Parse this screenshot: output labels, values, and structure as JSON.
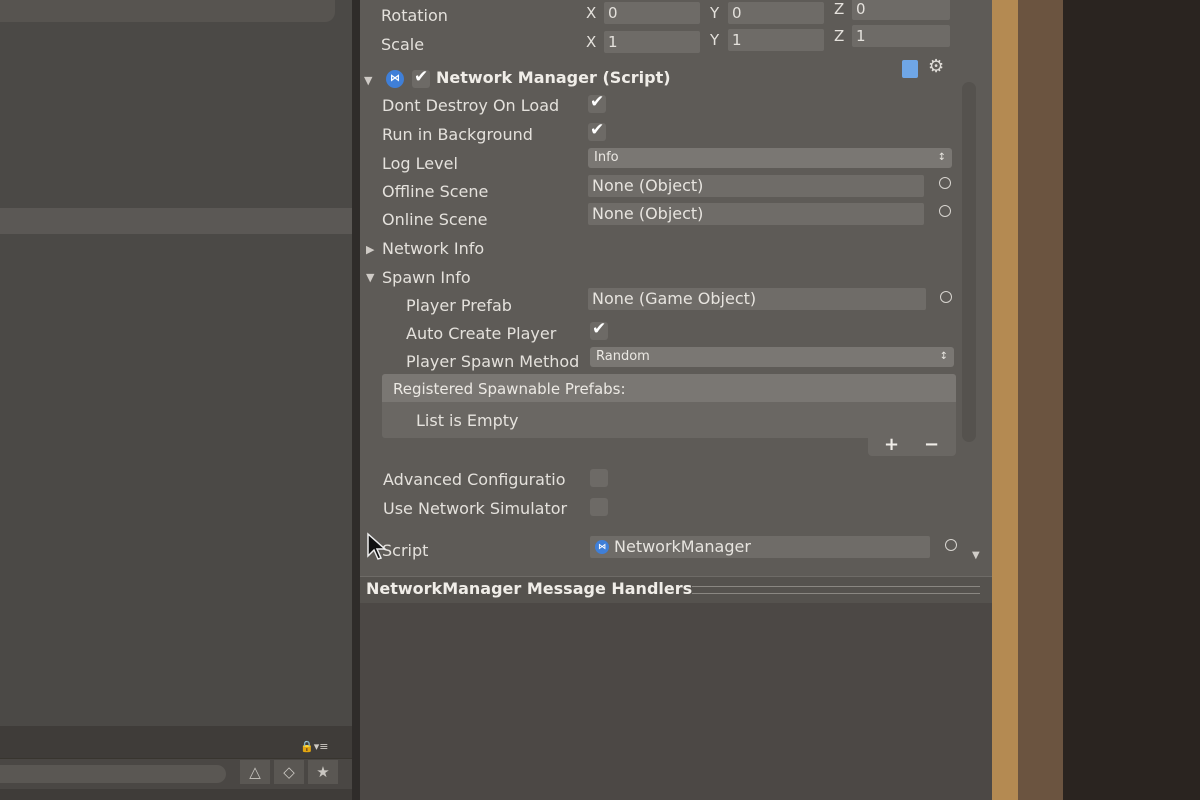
{
  "transform": {
    "rotation_label": "Rotation",
    "scale_label": "Scale",
    "rotation": {
      "x_axis": "X",
      "x": "0",
      "y_axis": "Y",
      "y": "0",
      "z_axis": "Z",
      "z": "0"
    },
    "scale": {
      "x_axis": "X",
      "x": "1",
      "y_axis": "Y",
      "y": "1",
      "z_axis": "Z",
      "z": "1"
    }
  },
  "component": {
    "title": "Network Manager (Script)",
    "icon_glyph": "⋈",
    "enabled": true
  },
  "fields": {
    "dont_destroy_label": "Dont Destroy On Load",
    "dont_destroy": true,
    "run_background_label": "Run in Background",
    "run_background": true,
    "log_level_label": "Log Level",
    "log_level": "Info",
    "offline_scene_label": "Offline Scene",
    "offline_scene": "None (Object)",
    "online_scene_label": "Online Scene",
    "online_scene": "None (Object)",
    "network_info_label": "Network Info",
    "spawn_info_label": "Spawn Info",
    "player_prefab_label": "Player Prefab",
    "player_prefab": "None (Game Object)",
    "auto_create_label": "Auto Create Player",
    "auto_create": true,
    "spawn_method_label": "Player Spawn Method",
    "spawn_method": "Random",
    "advanced_label": "Advanced Configuratio",
    "advanced": false,
    "simulator_label": "Use Network Simulator",
    "simulator": false,
    "script_label": "Script",
    "script_value": "NetworkManager"
  },
  "spawnable_list": {
    "title": "Registered Spawnable Prefabs:",
    "empty_text": "List is Empty",
    "add": "+",
    "remove": "−"
  },
  "handlers": {
    "title": "NetworkManager Message Handlers"
  },
  "icons": {
    "foldout_open": "▼",
    "foldout_closed": "▶",
    "dropdown_arrow": "↕",
    "gear": "⚙",
    "lock": "🔒",
    "menu": "▾≡",
    "star": "★"
  },
  "colors": {
    "accent": "#3f7fd8"
  }
}
